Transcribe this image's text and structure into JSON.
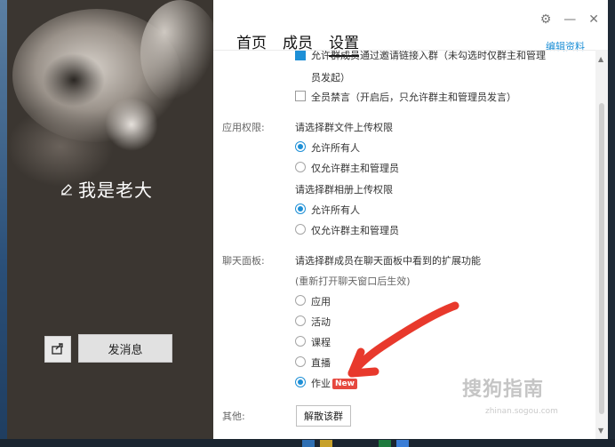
{
  "profile": {
    "nickname": "我是老大",
    "send_message_label": "发消息"
  },
  "header": {
    "tabs": [
      {
        "label": "首页",
        "active": false
      },
      {
        "label": "成员",
        "active": false
      },
      {
        "label": "设置",
        "active": true
      }
    ],
    "edit_profile_label": "编辑资料"
  },
  "settings": {
    "checkbox_items": [
      {
        "label_line1": "允许群成员通过邀请链接入群（未勾选时仅群主和管理",
        "label_line2": "员发起）",
        "checked": true
      },
      {
        "label": "全员禁言（开启后，只允许群主和管理员发言）",
        "checked": false
      }
    ],
    "app_permissions": {
      "label": "应用权限:",
      "file_prompt": "请选择群文件上传权限",
      "file_options": [
        {
          "label": "允许所有人",
          "selected": true
        },
        {
          "label": "仅允许群主和管理员",
          "selected": false
        }
      ],
      "album_prompt": "请选择群相册上传权限",
      "album_options": [
        {
          "label": "允许所有人",
          "selected": true
        },
        {
          "label": "仅允许群主和管理员",
          "selected": false
        }
      ]
    },
    "chat_panel": {
      "label": "聊天面板:",
      "prompt": "请选择群成员在聊天面板中看到的扩展功能",
      "note": "(重新打开聊天窗口后生效)",
      "options": [
        {
          "label": "应用",
          "selected": false
        },
        {
          "label": "活动",
          "selected": false
        },
        {
          "label": "课程",
          "selected": false
        },
        {
          "label": "直播",
          "selected": false
        },
        {
          "label": "作业",
          "selected": true,
          "badge": "New"
        }
      ]
    },
    "other": {
      "label": "其他:",
      "dissolve_label": "解散该群"
    }
  },
  "watermark": {
    "text": "搜狗指南",
    "url": "zhinan.sogou.com"
  },
  "colors": {
    "accent": "#1d8fd6",
    "badge": "#e6483f",
    "left_panel": "#3b3631",
    "annotation_arrow": "#e8392c"
  }
}
